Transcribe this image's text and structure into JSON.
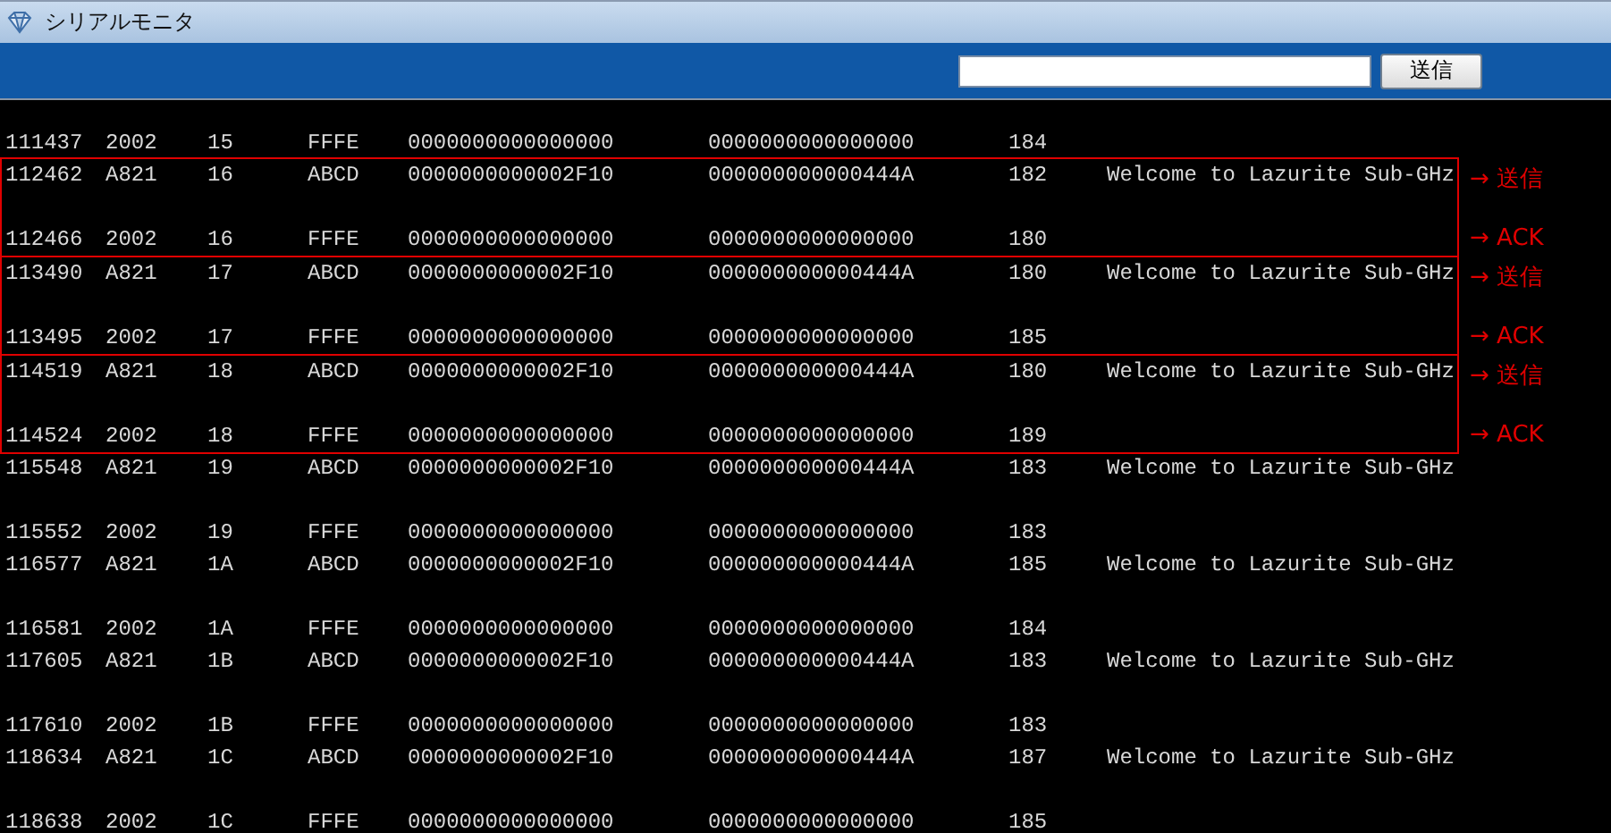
{
  "window": {
    "title": "シリアルモニタ"
  },
  "toolbar": {
    "send_button": "送信"
  },
  "log": [
    {
      "kind": "row",
      "cells": [
        "111437",
        "2002",
        "15",
        "FFFE",
        "0000000000000000",
        "0000000000000000",
        "184"
      ]
    },
    {
      "kind": "group",
      "notes": [
        "→ 送信",
        "→ ACK"
      ],
      "rows": [
        {
          "cells": [
            "112462",
            "A821",
            "16",
            "ABCD",
            "0000000000002F10",
            "000000000000444A",
            "182"
          ],
          "message": "Welcome to Lazurite Sub-GHz"
        },
        {
          "cells": [
            "112466",
            "2002",
            "16",
            "FFFE",
            "0000000000000000",
            "0000000000000000",
            "180"
          ]
        }
      ]
    },
    {
      "kind": "group",
      "notes": [
        "→ 送信",
        "→ ACK"
      ],
      "rows": [
        {
          "cells": [
            "113490",
            "A821",
            "17",
            "ABCD",
            "0000000000002F10",
            "000000000000444A",
            "180"
          ],
          "message": "Welcome to Lazurite Sub-GHz"
        },
        {
          "cells": [
            "113495",
            "2002",
            "17",
            "FFFE",
            "0000000000000000",
            "0000000000000000",
            "185"
          ]
        }
      ]
    },
    {
      "kind": "group",
      "notes": [
        "→ 送信",
        "→ ACK"
      ],
      "rows": [
        {
          "cells": [
            "114519",
            "A821",
            "18",
            "ABCD",
            "0000000000002F10",
            "000000000000444A",
            "180"
          ],
          "message": "Welcome to Lazurite Sub-GHz"
        },
        {
          "cells": [
            "114524",
            "2002",
            "18",
            "FFFE",
            "0000000000000000",
            "0000000000000000",
            "189"
          ]
        }
      ]
    },
    {
      "kind": "row",
      "cells": [
        "115548",
        "A821",
        "19",
        "ABCD",
        "0000000000002F10",
        "000000000000444A",
        "183"
      ],
      "message": "Welcome to Lazurite Sub-GHz"
    },
    {
      "kind": "row",
      "cells": [
        "115552",
        "2002",
        "19",
        "FFFE",
        "0000000000000000",
        "0000000000000000",
        "183"
      ]
    },
    {
      "kind": "row",
      "cells": [
        "116577",
        "A821",
        "1A",
        "ABCD",
        "0000000000002F10",
        "000000000000444A",
        "185"
      ],
      "message": "Welcome to Lazurite Sub-GHz"
    },
    {
      "kind": "row",
      "cells": [
        "116581",
        "2002",
        "1A",
        "FFFE",
        "0000000000000000",
        "0000000000000000",
        "184"
      ]
    },
    {
      "kind": "row",
      "cells": [
        "117605",
        "A821",
        "1B",
        "ABCD",
        "0000000000002F10",
        "000000000000444A",
        "183"
      ],
      "message": "Welcome to Lazurite Sub-GHz"
    },
    {
      "kind": "row",
      "cells": [
        "117610",
        "2002",
        "1B",
        "FFFE",
        "0000000000000000",
        "0000000000000000",
        "183"
      ]
    },
    {
      "kind": "row",
      "cells": [
        "118634",
        "A821",
        "1C",
        "ABCD",
        "0000000000002F10",
        "000000000000444A",
        "187"
      ],
      "message": "Welcome to Lazurite Sub-GHz"
    },
    {
      "kind": "row",
      "cells": [
        "118638",
        "2002",
        "1C",
        "FFFE",
        "0000000000000000",
        "0000000000000000",
        "185"
      ]
    }
  ]
}
